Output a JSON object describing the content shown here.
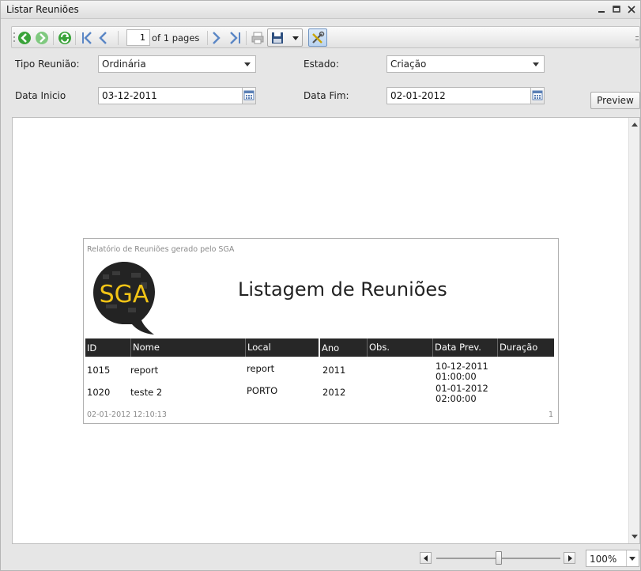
{
  "window": {
    "title": "Listar Reuniões"
  },
  "toolbar": {
    "page_number": "1",
    "of_pages": "of 1 pages"
  },
  "filters": {
    "tipo_label": "Tipo Reunião:",
    "tipo_value": "Ordinária",
    "estado_label": "Estado:",
    "estado_value": "Criação",
    "data_inicio_label": "Data Inicio",
    "data_inicio_value": "03-12-2011",
    "data_fim_label": "Data Fim:",
    "data_fim_value": "02-01-2012",
    "preview_label": "Preview"
  },
  "report": {
    "header_note": "Relatório de Reuniões gerado pelo SGA",
    "logo_text": "SGA",
    "title": "Listagem de Reuniões",
    "columns": [
      "ID",
      "Nome",
      "Local",
      "Ano",
      "Obs.",
      "Data Prev.",
      "Duração"
    ],
    "rows": [
      {
        "id": "1015",
        "nome": "report",
        "local": "report",
        "ano": "2011",
        "obs": "",
        "data_prev_date": "10-12-2011",
        "data_prev_time": "01:00:00",
        "duracao": ""
      },
      {
        "id": "1020",
        "nome": "teste 2",
        "local": "PORTO",
        "ano": "2012",
        "obs": "",
        "data_prev_date": "01-01-2012",
        "data_prev_time": "02:00:00",
        "duracao": ""
      }
    ],
    "footer_timestamp": "02-01-2012 12:10:13",
    "footer_page": "1"
  },
  "statusbar": {
    "zoom": "100%",
    "zoom_slider_fraction": 0.5
  },
  "colors": {
    "accent_yellow": "#f2c416",
    "logo_dark": "#222222",
    "header_bg": "#272727"
  },
  "icons": [
    "back-icon",
    "forward-icon",
    "refresh-icon",
    "first-page-icon",
    "prev-page-icon",
    "next-page-icon",
    "last-page-icon",
    "print-icon",
    "save-icon",
    "tools-icon",
    "calendar-icon"
  ]
}
